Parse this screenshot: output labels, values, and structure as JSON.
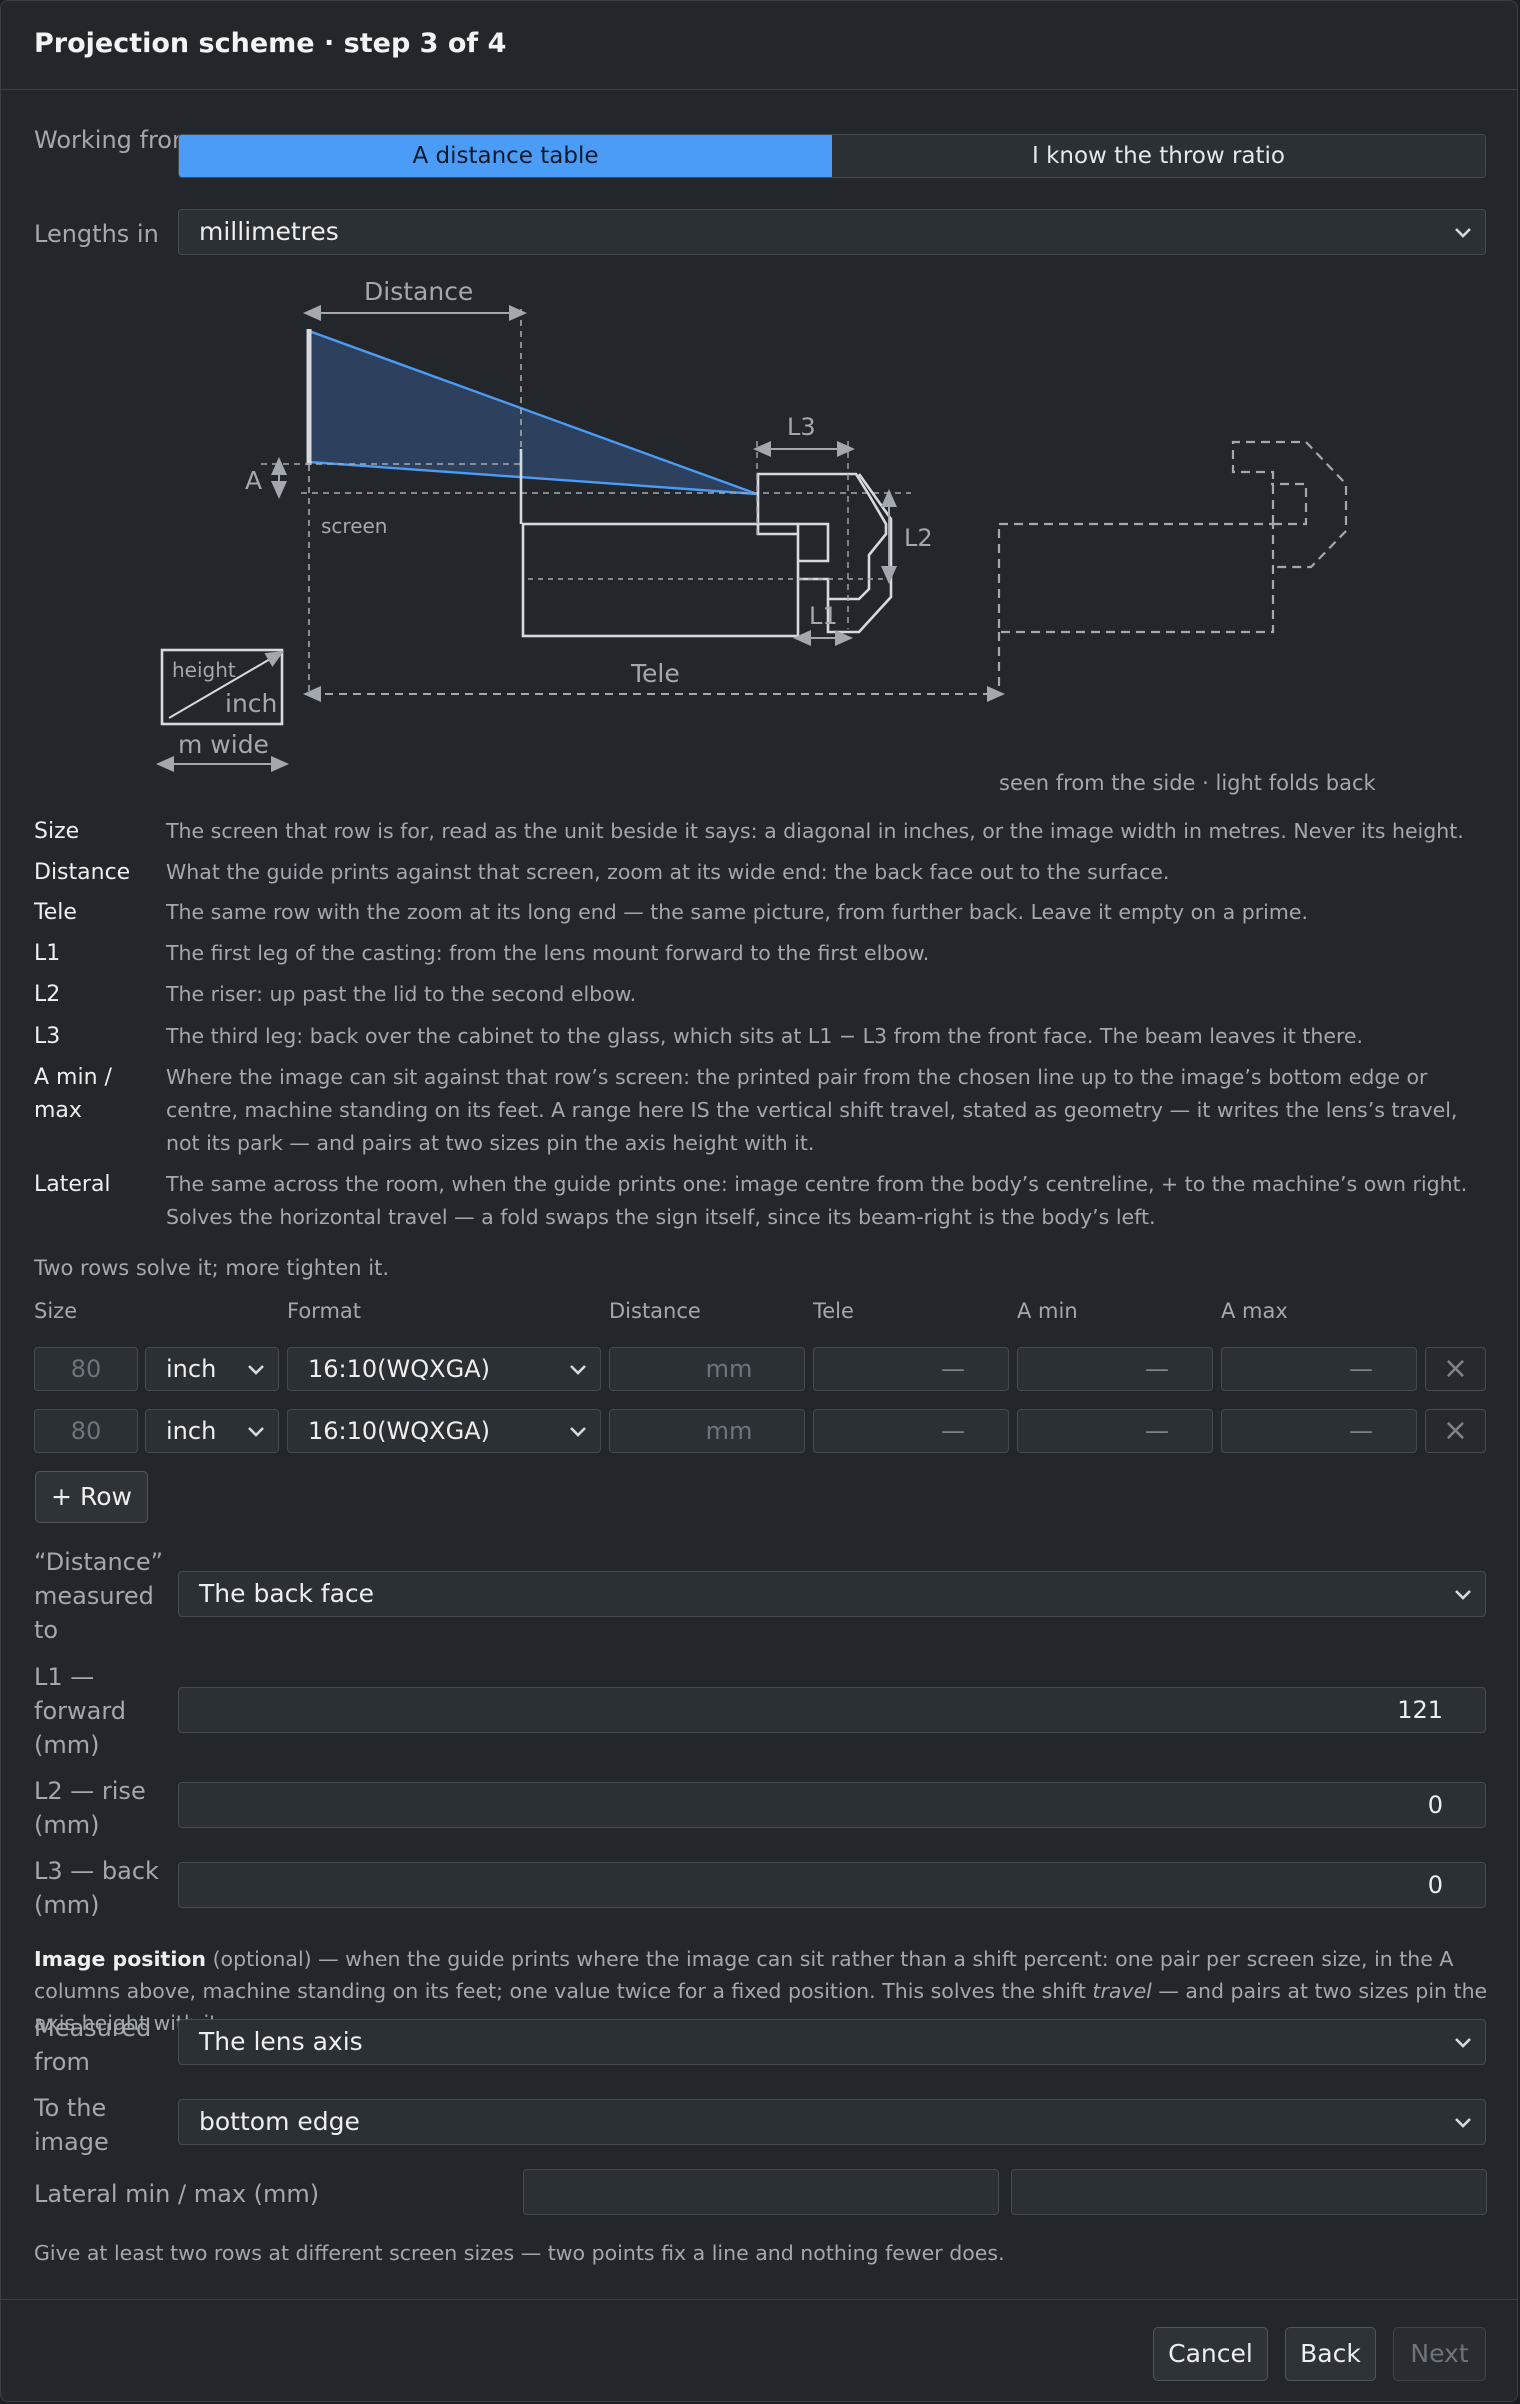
{
  "title": "Projection scheme · step 3 of 4",
  "working_from": {
    "label": "Working from",
    "options": [
      "A distance table",
      "I know the throw ratio"
    ],
    "selected": 0
  },
  "lengths_in": {
    "label": "Lengths in",
    "value": "millimetres"
  },
  "diagram": {
    "labels": {
      "distance": "Distance",
      "a": "A",
      "screen": "screen",
      "l1": "L1",
      "l2": "L2",
      "l3": "L3",
      "tele": "Tele",
      "height": "height",
      "inch": "inch",
      "m_wide": "m wide"
    },
    "caption": "seen from the side · light folds back"
  },
  "definitions": [
    {
      "term": "Size",
      "text": "The screen that row is for, read as the unit beside it says: a diagonal in inches, or the image width in metres. Never its height."
    },
    {
      "term": "Distance",
      "text": "What the guide prints against that screen, zoom at its wide end: the back face out to the surface."
    },
    {
      "term": "Tele",
      "text": "The same row with the zoom at its long end — the same picture, from further back. Leave it empty on a prime."
    },
    {
      "term": "L1",
      "text": "The first leg of the casting: from the lens mount forward to the first elbow."
    },
    {
      "term": "L2",
      "text": "The riser: up past the lid to the second elbow."
    },
    {
      "term": "L3",
      "text": "The third leg: back over the cabinet to the glass, which sits at L1 − L3 from the front face. The beam leaves it there."
    },
    {
      "term": "A min / max",
      "text": "Where the image can sit against that row’s screen: the printed pair from the chosen line up to the image’s bottom edge or centre, machine standing on its feet. A range here IS the vertical shift travel, stated as geometry — it writes the lens’s travel, not its park — and pairs at two sizes pin the axis height with it."
    },
    {
      "term": "Lateral",
      "text": "The same across the room, when the guide prints one: image centre from the body’s centreline, + to the machine’s own right. Solves the horizontal travel — a fold swaps the sign itself, since its beam-right is the body’s left."
    }
  ],
  "rows_note": "Two rows solve it; more tighten it.",
  "table": {
    "headers": [
      "Size",
      "Format",
      "Distance",
      "Tele",
      "A min",
      "A max"
    ],
    "rows": [
      {
        "size": "80",
        "unit": "inch",
        "format": "16:10(WQXGA)",
        "distance": "mm",
        "tele": "—",
        "amin": "—",
        "amax": "—"
      },
      {
        "size": "80",
        "unit": "inch",
        "format": "16:10(WQXGA)",
        "distance": "mm",
        "tele": "—",
        "amin": "—",
        "amax": "—"
      }
    ],
    "remove_glyph": "×",
    "add_row": "+ Row"
  },
  "distance_measured": {
    "label_lines": [
      "“Distance”",
      "measured",
      "to"
    ],
    "value": "The back face"
  },
  "l1": {
    "label_lines": [
      "L1 —",
      "forward",
      "(mm)"
    ],
    "value": "121"
  },
  "l2": {
    "label_lines": [
      "L2 — rise",
      "(mm)"
    ],
    "value": "0"
  },
  "l3": {
    "label_lines": [
      "L3 — back",
      "(mm)"
    ],
    "value": "0"
  },
  "image_position": {
    "title": "Image position",
    "optional": "(optional)",
    "text_a": " — when the guide prints where the image can sit rather than a shift percent: one pair per screen size, in the A columns above, machine standing on its feet; one value twice for a fixed position. This solves the shift ",
    "travel": "travel",
    "text_b": " — and pairs at two sizes pin the axis height with it."
  },
  "measured_from": {
    "label_lines": [
      "Measured",
      "from"
    ],
    "value": "The lens axis"
  },
  "to_image": {
    "label_lines": [
      "To the",
      "image"
    ],
    "value": "bottom edge"
  },
  "lateral": {
    "label": "Lateral min / max (mm)",
    "min": "",
    "max": ""
  },
  "hint": "Give at least two rows at different screen sizes — two points fix a line and nothing fewer does.",
  "footer": {
    "cancel": "Cancel",
    "back": "Back",
    "next": "Next"
  },
  "colors": {
    "accent": "#4a9cf7",
    "beam": "#4a9cf7"
  }
}
